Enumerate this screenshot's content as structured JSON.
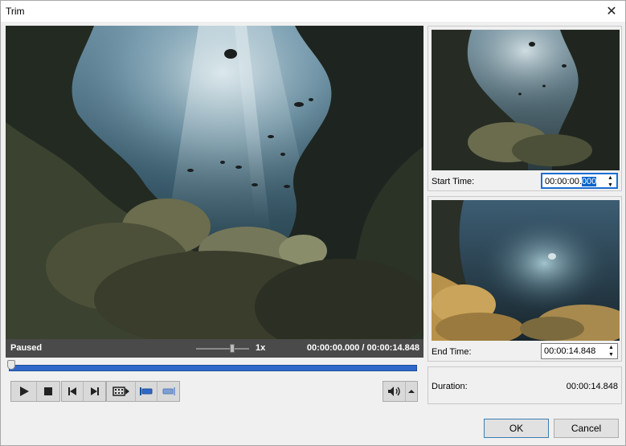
{
  "window": {
    "title": "Trim",
    "close_glyph": "✕"
  },
  "player": {
    "status": "Paused",
    "speed_label": "1x",
    "time_current": "00:00:00.000",
    "time_separator": " / ",
    "time_total": "00:00:14.848",
    "speed_slider_fraction": 0.7,
    "timeline_position_fraction": 0.0,
    "accent_color": "#2f68c8"
  },
  "controls": {
    "play": "play-icon",
    "stop": "stop-icon",
    "previous_frame": "previous-frame-icon",
    "next_frame": "next-frame-icon",
    "clip": "film-clip-icon",
    "mark_in": "mark-in-icon",
    "mark_out": "mark-out-icon",
    "volume": "speaker-icon",
    "volume_menu": "chevron-up-icon"
  },
  "start": {
    "label": "Start Time:",
    "value_prefix": "00:00:00.",
    "value_selected": "000"
  },
  "end": {
    "label": "End Time:",
    "value": "00:00:14.848"
  },
  "duration": {
    "label": "Duration:",
    "value": "00:00:14.848"
  },
  "buttons": {
    "ok": "OK",
    "cancel": "Cancel"
  }
}
